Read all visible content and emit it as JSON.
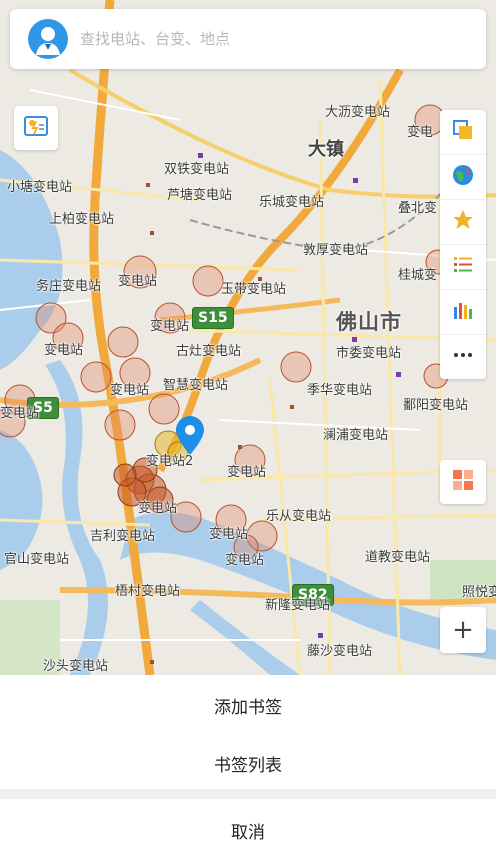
{
  "search": {
    "placeholder": "查找电站、台变、地点"
  },
  "map": {
    "city_label": "佛山市",
    "town_labels": [
      "大沥",
      "大镇"
    ],
    "road_shields": [
      "S15",
      "S5",
      "S82"
    ],
    "stations": [
      "大沥变电站",
      "变电",
      "双铁变电站",
      "小塘变电站",
      "芦塘变电站",
      "乐城变电站",
      "叠北变",
      "上柏变电站",
      "敦厚变电站",
      "桂城变",
      "务庄变电站",
      "变电站",
      "玉带变电站",
      "变电站",
      "古灶变电站",
      "市委变电站",
      "变电站",
      "变电站",
      "智慧变电站",
      "季华变电站",
      "鄱阳变电站",
      "变电站",
      "澜浦变电站",
      "变电站2",
      "变电站",
      "变电站",
      "乐从变电站",
      "吉利变电站",
      "变电站",
      "道教变电站",
      "官山变电站",
      "变电站",
      "梧村变电站",
      "新隆变电站",
      "照悦变",
      "藤沙变电站",
      "沙头变电站"
    ]
  },
  "toolbar": {
    "left_icon": "weather-icon",
    "right_icons": [
      "layers-icon",
      "globe-icon",
      "star-icon",
      "list-icon",
      "bar-chart-icon",
      "more-icon"
    ],
    "grid_icon": "grid-icon",
    "zoom_in": "+"
  },
  "sheet": {
    "add_bookmark": "添加书签",
    "bookmark_list": "书签列表",
    "cancel": "取消"
  }
}
